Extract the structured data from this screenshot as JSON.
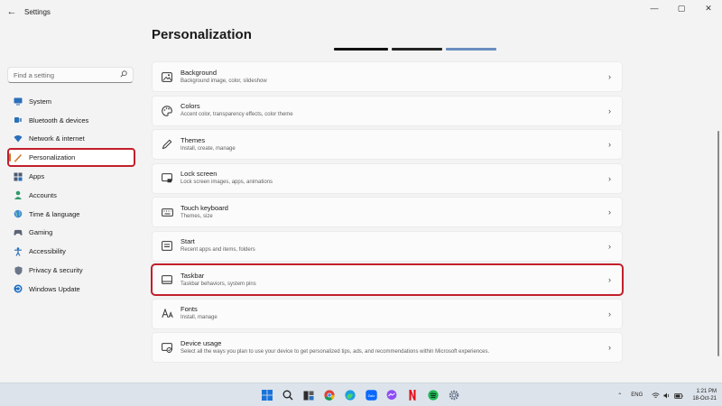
{
  "window": {
    "title": "Settings",
    "minimize": "—",
    "maximize": "▢",
    "close": "✕"
  },
  "back_glyph": "←",
  "search": {
    "placeholder": "Find a setting"
  },
  "sidebar": {
    "items": [
      {
        "label": "System",
        "icon": "monitor-icon"
      },
      {
        "label": "Bluetooth & devices",
        "icon": "bluetooth-icon"
      },
      {
        "label": "Network & internet",
        "icon": "wifi-icon"
      },
      {
        "label": "Personalization",
        "icon": "brush-icon",
        "active": true
      },
      {
        "label": "Apps",
        "icon": "apps-icon"
      },
      {
        "label": "Accounts",
        "icon": "person-icon"
      },
      {
        "label": "Time & language",
        "icon": "globe-icon"
      },
      {
        "label": "Gaming",
        "icon": "gamepad-icon"
      },
      {
        "label": "Accessibility",
        "icon": "accessibility-icon"
      },
      {
        "label": "Privacy & security",
        "icon": "shield-icon"
      },
      {
        "label": "Windows Update",
        "icon": "update-icon"
      }
    ]
  },
  "main": {
    "title": "Personalization",
    "cards": [
      {
        "title": "Background",
        "subtitle": "Background image, color, slideshow",
        "icon": "image-icon"
      },
      {
        "title": "Colors",
        "subtitle": "Accent color, transparency effects, color theme",
        "icon": "palette-icon"
      },
      {
        "title": "Themes",
        "subtitle": "Install, create, manage",
        "icon": "pen-icon"
      },
      {
        "title": "Lock screen",
        "subtitle": "Lock screen images, apps, animations",
        "icon": "lock-screen-icon"
      },
      {
        "title": "Touch keyboard",
        "subtitle": "Themes, size",
        "icon": "keyboard-icon"
      },
      {
        "title": "Start",
        "subtitle": "Recent apps and items, folders",
        "icon": "start-menu-icon"
      },
      {
        "title": "Taskbar",
        "subtitle": "Taskbar behaviors, system pins",
        "icon": "taskbar-icon",
        "highlight": true
      },
      {
        "title": "Fonts",
        "subtitle": "Install, manage",
        "icon": "fonts-icon"
      },
      {
        "title": "Device usage",
        "subtitle": "Select all the ways you plan to use your device to get personalized tips, ads, and recommendations within Microsoft experiences.",
        "icon": "device-usage-icon"
      }
    ],
    "chevron": "›"
  },
  "taskbar": {
    "apps": [
      "windows-start-icon",
      "search-icon",
      "task-view-icon",
      "chrome-icon",
      "edge-icon",
      "zalo-icon",
      "messenger-icon",
      "netflix-icon",
      "spotify-icon",
      "settings-gear-icon"
    ],
    "zalo_label": "Zalo",
    "language": "ENG",
    "time": "1:21 PM",
    "date": "18-Oct-21"
  },
  "colors": {
    "highlight_red": "#c21f2b",
    "accent": "#0067c0"
  }
}
